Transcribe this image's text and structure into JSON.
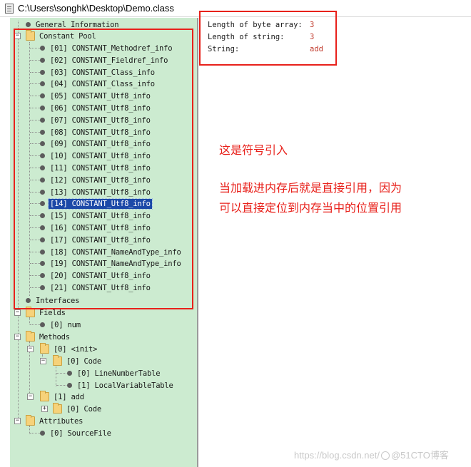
{
  "window": {
    "title": "C:\\Users\\songhk\\Desktop\\Demo.class"
  },
  "tree": {
    "general_information": "General Information",
    "constant_pool": {
      "label": "Constant Pool",
      "items": [
        "[01] CONSTANT_Methodref_info",
        "[02] CONSTANT_Fieldref_info",
        "[03] CONSTANT_Class_info",
        "[04] CONSTANT_Class_info",
        "[05] CONSTANT_Utf8_info",
        "[06] CONSTANT_Utf8_info",
        "[07] CONSTANT_Utf8_info",
        "[08] CONSTANT_Utf8_info",
        "[09] CONSTANT_Utf8_info",
        "[10] CONSTANT_Utf8_info",
        "[11] CONSTANT_Utf8_info",
        "[12] CONSTANT_Utf8_info",
        "[13] CONSTANT_Utf8_info",
        "[14] CONSTANT_Utf8_info",
        "[15] CONSTANT_Utf8_info",
        "[16] CONSTANT_Utf8_info",
        "[17] CONSTANT_Utf8_info",
        "[18] CONSTANT_NameAndType_info",
        "[19] CONSTANT_NameAndType_info",
        "[20] CONSTANT_Utf8_info",
        "[21] CONSTANT_Utf8_info"
      ],
      "selected_index": 13
    },
    "interfaces": "Interfaces",
    "fields": {
      "label": "Fields",
      "items": [
        "[0] num"
      ]
    },
    "methods": {
      "label": "Methods",
      "init": {
        "label": "[0] <init>",
        "code": {
          "label": "[0] Code",
          "items": [
            "[0] LineNumberTable",
            "[1] LocalVariableTable"
          ]
        }
      },
      "add": {
        "label": "[1] add",
        "code": "[0] Code"
      }
    },
    "attributes": {
      "label": "Attributes",
      "items": [
        "[0] SourceFile"
      ]
    }
  },
  "details": [
    {
      "label": "Length of byte array:",
      "value": "3"
    },
    {
      "label": "Length of string:",
      "value": "3"
    },
    {
      "label": "String:",
      "value": "add"
    }
  ],
  "annotation": {
    "line1": "这是符号引入",
    "line2": "当加载进内存后就是直接引用，因为",
    "line3": "可以直接定位到内存当中的位置引用"
  },
  "watermark": {
    "left": "https://blog.csdn.net/",
    "right": "@51CTO博客"
  },
  "colors": {
    "tree_bg": "#ccebd0",
    "selection": "#1c49a8",
    "highlight_box": "#e8211b",
    "value_text": "#c0392b"
  },
  "icons": {
    "folder": "folder-icon",
    "leaf": "bullet-icon",
    "expand": "plus-icon",
    "collapse": "minus-icon"
  }
}
